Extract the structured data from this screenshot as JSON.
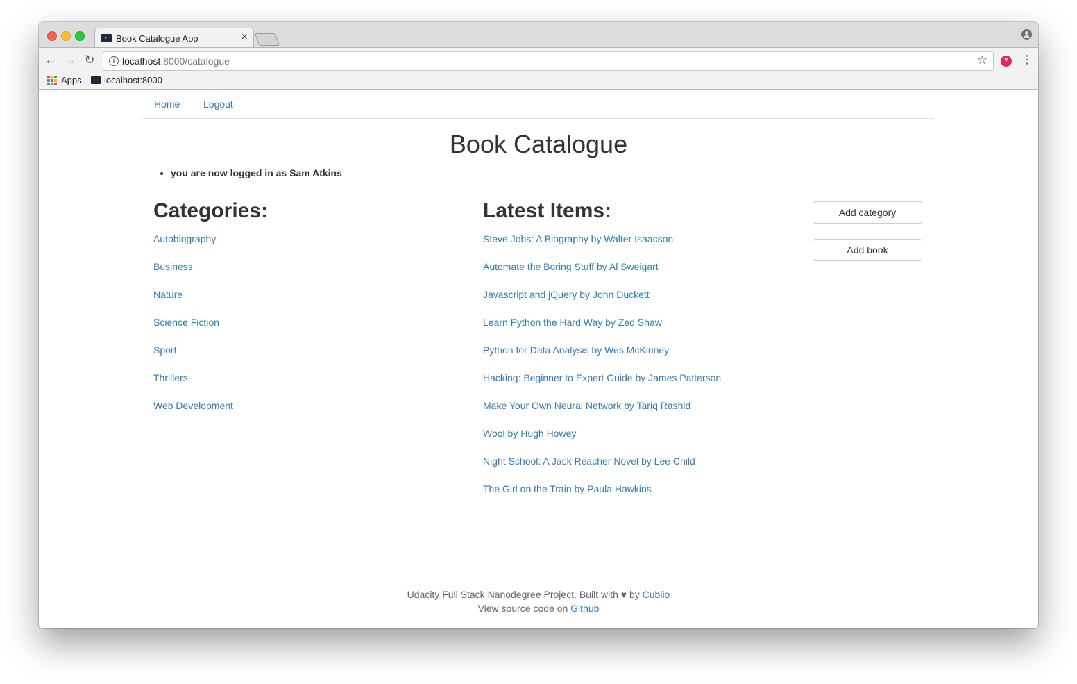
{
  "browser": {
    "tab_title": "Book Catalogue App",
    "tab_close": "×",
    "url_host": "localhost",
    "url_path": ":8000/catalogue",
    "bookmarks": [
      {
        "label": "Apps"
      },
      {
        "label": "localhost:8000"
      }
    ],
    "extension_glyph": "Y"
  },
  "nav": {
    "home": "Home",
    "logout": "Logout"
  },
  "page": {
    "title": "Book Catalogue",
    "flash_message": "you are now logged in as Sam Atkins"
  },
  "categories": {
    "heading": "Categories:",
    "items": [
      "Autobiography",
      "Business",
      "Nature",
      "Science Fiction",
      "Sport",
      "Thrillers",
      "Web Development"
    ]
  },
  "latest": {
    "heading": "Latest Items:",
    "items": [
      "Steve Jobs: A Biography by Walter Isaacson",
      "Automate the Boring Stuff by Al Sweigart",
      "Javascript and jQuery by John Duckett",
      "Learn Python the Hard Way by Zed Shaw",
      "Python for Data Analysis by Wes McKinney",
      "Hacking: Beginner to Expert Guide by James Patterson",
      "Make Your Own Neural Network by Tariq Rashid",
      "Wool by Hugh Howey",
      "Night School: A Jack Reacher Novel by Lee Child",
      "The Girl on the Train by Paula Hawkins"
    ]
  },
  "actions": {
    "add_category": "Add category",
    "add_book": "Add book"
  },
  "footer": {
    "line1_text": "Udacity Full Stack Nanodegree Project. Built with ♥ by ",
    "line1_link": "Cubiio",
    "line2_text": "View source code on ",
    "line2_link": "Github"
  },
  "colors": {
    "link": "#337ab7",
    "text": "#333333",
    "extension": "#e8245c"
  }
}
